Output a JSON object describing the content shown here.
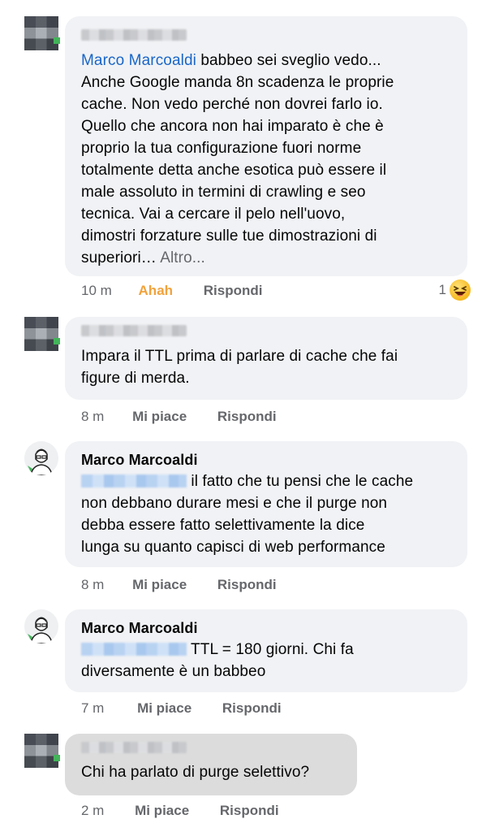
{
  "comments": [
    {
      "author_redacted": true,
      "mention": "Marco Marcoaldi",
      "lines": [
        " babbeo sei sveglio vedo...",
        "Anche Google manda 8n scadenza le proprie",
        "cache. Non vedo perché non dovrei farlo io.",
        "Quello che ancora non hai imparato è che è",
        "proprio la tua configurazione fuori norme",
        "totalmente detta anche esotica può essere il",
        "male assoluto in termini di crawling e seo",
        "tecnica.  Vai a cercare il pelo nell'uovo,",
        "dimostri forzature sulle tue dimostrazioni di"
      ],
      "last_line": "superiori…",
      "more_label": " Altro...",
      "time": "10 m",
      "like_label": "Ahah",
      "reply_label": "Rispondi",
      "reaction_count": "1",
      "reaction_icon": "laughing-emoji-icon"
    },
    {
      "author_redacted": true,
      "lines": [
        "Impara il TTL prima di parlare di cache che fai",
        "figure di merda."
      ],
      "time": "8 m",
      "like_label": "Mi piace",
      "reply_label": "Rispondi"
    },
    {
      "author": "Marco Marcoaldi",
      "mention_redacted": true,
      "first_line": " il fatto che tu pensi che le cache",
      "lines": [
        "non debbano durare mesi e che il purge non",
        "debba essere fatto selettivamente la dice",
        "lunga su quanto capisci di web performance"
      ],
      "time": "8 m",
      "like_label": "Mi piace",
      "reply_label": "Rispondi"
    },
    {
      "author": "Marco Marcoaldi",
      "mention_redacted": true,
      "first_line": " TTL = 180 giorni. Chi fa",
      "lines": [
        "diversamente è un babbeo"
      ],
      "time": "7 m",
      "like_label": "Mi piace",
      "reply_label": "Rispondi"
    },
    {
      "author_redacted": true,
      "lines": [
        "Chi ha parlato di purge selettivo?"
      ],
      "time": "2 m",
      "like_label": "Mi piace",
      "reply_label": "Rispondi"
    }
  ],
  "colors": {
    "bubble": "#f0f2f5",
    "bubble_pressed": "#dcdcdc",
    "mention": "#1a66c8",
    "meta": "#65676b",
    "ahah": "#f2a23b"
  }
}
